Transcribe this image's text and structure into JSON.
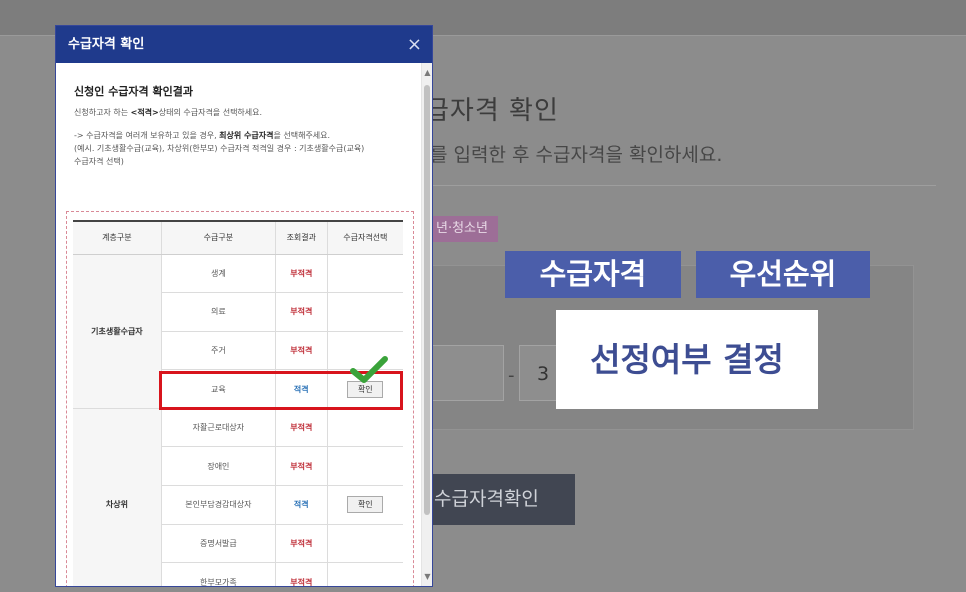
{
  "background": {
    "title": "급자격 확인",
    "subtitle": "를 입력한 후 수급자격을 확인하세요.",
    "tag": "년·청소년",
    "field_value": "3",
    "button_label": "수급자격확인"
  },
  "captions": {
    "eligibility": "수급자격",
    "priority": "우선순위",
    "selection": "선정여부 결정"
  },
  "modal": {
    "title": "수급자격 확인",
    "close": "×",
    "result_title": "신청인 수급자격 확인결과",
    "instruction_pre": "신청하고자 하는 ",
    "instruction_bold": "<적격>",
    "instruction_post": "상태의 수급자격을 선택하세요.",
    "note_line1_pre": "-> 수급자격을 여러개 보유하고 있을 경우, ",
    "note_line1_bold": "최상위 수급자격",
    "note_line1_post": "을 선택해주세요.",
    "note_line2": "(예시. 기초생활수급(교육), 차상위(한부모) 수급자격 적격일 경우 : 기초생활수급(교육)",
    "note_line3": "수급자격 선택)",
    "table": {
      "headers": [
        "계층구분",
        "수급구분",
        "조회결과",
        "수급자격선택"
      ],
      "group1": "기초생활수급자",
      "group2": "차상위",
      "select_label": "확인",
      "rows": [
        {
          "type": "생계",
          "result": "부적격"
        },
        {
          "type": "의료",
          "result": "부적격"
        },
        {
          "type": "주거",
          "result": "부적격"
        },
        {
          "type": "교육",
          "result": "적격"
        },
        {
          "type": "자활근로대상자",
          "result": "부적격"
        },
        {
          "type": "장애인",
          "result": "부적격"
        },
        {
          "type": "본인부담경감대상자",
          "result": "적격"
        },
        {
          "type": "증명서발급",
          "result": "부적격"
        },
        {
          "type": "한부모가족",
          "result": "부적격"
        }
      ]
    }
  },
  "colors": {
    "modal_header": "#1f3a8c",
    "ineligible": "#c0313b",
    "eligible": "#2d74b8",
    "highlight": "#d8141c",
    "check": "#3aa33a",
    "caption_blue": "#4b5eaa"
  }
}
